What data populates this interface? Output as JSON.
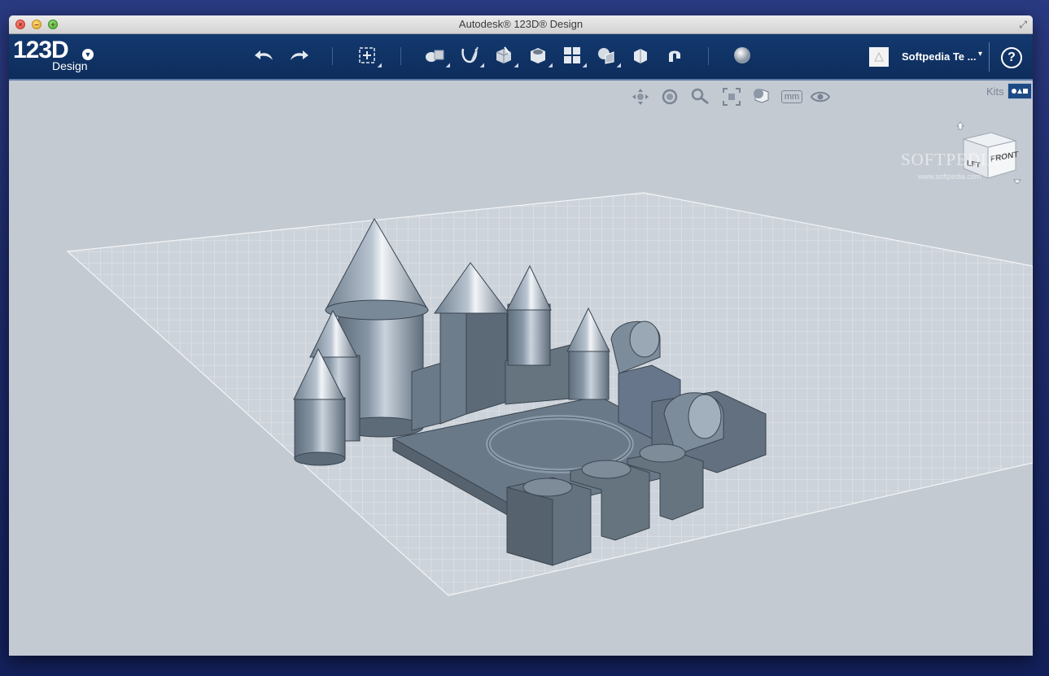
{
  "window": {
    "title": "Autodesk® 123D® Design"
  },
  "logo": {
    "main": "123D",
    "sub": "Design"
  },
  "toolbar": {
    "tools": [
      {
        "name": "undo",
        "icon": "undo-arrow-icon"
      },
      {
        "name": "redo",
        "icon": "redo-arrow-icon"
      },
      {
        "name": "transform",
        "icon": "transform-icon"
      },
      {
        "name": "primitives",
        "icon": "primitives-icon"
      },
      {
        "name": "sketch",
        "icon": "sketch-icon"
      },
      {
        "name": "construct",
        "icon": "construct-icon"
      },
      {
        "name": "modify",
        "icon": "modify-icon"
      },
      {
        "name": "pattern",
        "icon": "pattern-icon"
      },
      {
        "name": "grouping",
        "icon": "grouping-icon"
      },
      {
        "name": "combine",
        "icon": "combine-icon"
      },
      {
        "name": "snap",
        "icon": "snap-magnet-icon"
      },
      {
        "name": "material",
        "icon": "material-sphere-icon"
      }
    ]
  },
  "user": {
    "name": "Softpedia Te ..."
  },
  "help": {
    "label": "?"
  },
  "viewport": {
    "nav_tools": [
      "pan-icon",
      "orbit-icon",
      "zoom-icon",
      "fit-icon",
      "view-style-icon",
      "units-icon",
      "visibility-icon"
    ],
    "units": "mm",
    "kits_label": "Kits",
    "viewcube": {
      "left": "LFT",
      "front": "FRONT"
    }
  },
  "watermark": {
    "text": "SOFTPEDIA",
    "url": "www.softpedia.com"
  },
  "colors": {
    "toolbar": "#0d2d5c",
    "viewport": "#c4cad2",
    "model": "#6f7f8e"
  }
}
